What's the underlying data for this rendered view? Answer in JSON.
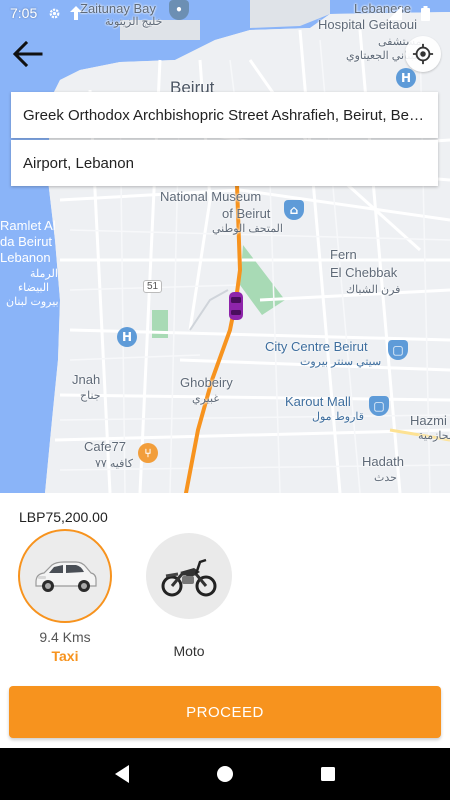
{
  "status_bar": {
    "time": "7:05"
  },
  "map": {
    "labels": {
      "zaitunay_bay": "Zaitunay Bay",
      "zaitunay_bay_ar": "خليج الزيتونة",
      "lebanese": "Lebanese",
      "hospital_geitaoui": "Hospital Geitaoui",
      "hospital_geitaoui_ar": "مستشفى",
      "hospital_geitaoui_ar2": "اللبناني الجعيتاوي",
      "beirut": "Beirut",
      "national_museum": "National Museum",
      "of_beirut": "of Beirut",
      "national_museum_ar": "المتحف الوطني",
      "ramlet_al": "Ramlet Al",
      "da_beirut": "da Beirut",
      "lebanon": "Lebanon",
      "ramlet_ar1": "الرملة",
      "ramlet_ar2": "البيضاء",
      "ramlet_ar3": "بيروت لبنان",
      "el_chebbak": "El Chebbak",
      "el_chebbak_prefix": "Fern",
      "el_chebbak_ar": "فرن الشباك",
      "route_51": "51",
      "city_centre": "City Centre Beirut",
      "city_centre_ar": "سيتي سنتر بيروت",
      "jnah": "Jnah",
      "jnah_ar": "جناح",
      "ghobeiry": "Ghobeiry",
      "ghobeiry_ar": "غبيري",
      "karout_mall": "Karout Mall",
      "karout_mall_ar": "قاروط مول",
      "hazmieh": "Hazmi",
      "hazmieh_ar": "الحازمية",
      "cafe77": "Cafe77",
      "cafe77_ar": "كافيه ٧٧",
      "hadath": "Hadath",
      "hadath_ar": "حدث"
    }
  },
  "search": {
    "pickup": "Greek Orthodox Archbishopric Street Ashrafieh, Beirut, Beirut",
    "dropoff": "Airport, Lebanon"
  },
  "fare": {
    "price": "LBP75,200.00"
  },
  "vehicles": [
    {
      "name": "Taxi",
      "distance": "9.4 Kms",
      "selected": true
    },
    {
      "name": "Moto",
      "distance": "",
      "selected": false
    }
  ],
  "actions": {
    "proceed": "PROCEED"
  },
  "colors": {
    "accent": "#f7931e",
    "route": "#f7931e",
    "car": "#8e24aa"
  }
}
